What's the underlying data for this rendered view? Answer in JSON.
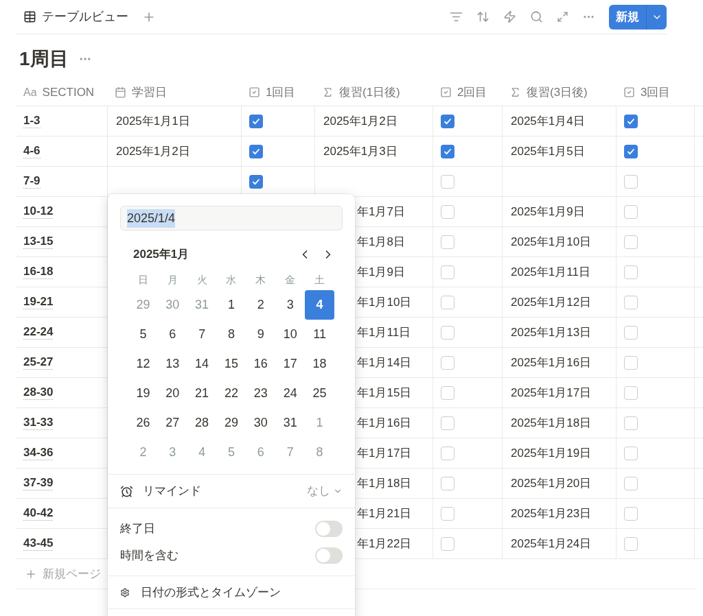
{
  "toolbar": {
    "view_tab": "テーブルビュー",
    "new_button": "新規"
  },
  "title": "1周目",
  "table": {
    "columns": [
      {
        "kind": "title",
        "prefix": "Aa",
        "label": "SECTION"
      },
      {
        "kind": "date",
        "label": "学習日"
      },
      {
        "kind": "checkbox",
        "label": "1回目"
      },
      {
        "kind": "formula",
        "label": "復習(1日後)"
      },
      {
        "kind": "checkbox",
        "label": "2回目"
      },
      {
        "kind": "formula",
        "label": "復習(3日後)"
      },
      {
        "kind": "checkbox",
        "label": "3回目"
      }
    ],
    "rows": [
      {
        "section": "1-3",
        "date": "2025年1月1日",
        "check1": true,
        "review1": "2025年1月2日",
        "check2": true,
        "review3": "2025年1月4日",
        "check3": true
      },
      {
        "section": "4-6",
        "date": "2025年1月2日",
        "check1": true,
        "review1": "2025年1月3日",
        "check2": true,
        "review3": "2025年1月5日",
        "check3": true
      },
      {
        "section": "7-9",
        "check1": true,
        "check2": false,
        "check3": false
      },
      {
        "section": "10-12",
        "review1": "年1月7日",
        "check2": false,
        "review3": "2025年1月9日",
        "check3": false
      },
      {
        "section": "13-15",
        "review1": "年1月8日",
        "check2": false,
        "review3": "2025年1月10日",
        "check3": false
      },
      {
        "section": "16-18",
        "review1": "年1月9日",
        "check2": false,
        "review3": "2025年1月11日",
        "check3": false
      },
      {
        "section": "19-21",
        "review1": "年1月10日",
        "check2": false,
        "review3": "2025年1月12日",
        "check3": false
      },
      {
        "section": "22-24",
        "review1": "年1月11日",
        "check2": false,
        "review3": "2025年1月13日",
        "check3": false
      },
      {
        "section": "25-27",
        "review1": "年1月14日",
        "check2": false,
        "review3": "2025年1月16日",
        "check3": false
      },
      {
        "section": "28-30",
        "review1": "年1月15日",
        "check2": false,
        "review3": "2025年1月17日",
        "check3": false
      },
      {
        "section": "31-33",
        "review1": "年1月16日",
        "check2": false,
        "review3": "2025年1月18日",
        "check3": false
      },
      {
        "section": "34-36",
        "review1": "年1月17日",
        "check2": false,
        "review3": "2025年1月19日",
        "check3": false
      },
      {
        "section": "37-39",
        "review1": "年1月18日",
        "check2": false,
        "review3": "2025年1月20日",
        "check3": false
      },
      {
        "section": "40-42",
        "review1": "年1月21日",
        "check2": false,
        "review3": "2025年1月23日",
        "check3": false
      },
      {
        "section": "43-45",
        "review1": "年1月22日",
        "check2": false,
        "review3": "2025年1月24日",
        "check3": false
      }
    ],
    "new_page": "新規ページ"
  },
  "date_picker": {
    "value": "2025/1/4",
    "month": "2025年1月",
    "weekdays": [
      "日",
      "月",
      "火",
      "水",
      "木",
      "金",
      "土"
    ],
    "weeks": [
      [
        {
          "day": "29",
          "muted": true,
          "selected": false
        },
        {
          "day": "30",
          "muted": true,
          "selected": false
        },
        {
          "day": "31",
          "muted": true,
          "selected": false
        },
        {
          "day": "1",
          "muted": false,
          "selected": false
        },
        {
          "day": "2",
          "muted": false,
          "selected": false
        },
        {
          "day": "3",
          "muted": false,
          "selected": false
        },
        {
          "day": "4",
          "muted": false,
          "selected": true
        }
      ],
      [
        {
          "day": "5",
          "muted": false,
          "selected": false
        },
        {
          "day": "6",
          "muted": false,
          "selected": false
        },
        {
          "day": "7",
          "muted": false,
          "selected": false
        },
        {
          "day": "8",
          "muted": false,
          "selected": false
        },
        {
          "day": "9",
          "muted": false,
          "selected": false
        },
        {
          "day": "10",
          "muted": false,
          "selected": false
        },
        {
          "day": "11",
          "muted": false,
          "selected": false
        }
      ],
      [
        {
          "day": "12",
          "muted": false,
          "selected": false
        },
        {
          "day": "13",
          "muted": false,
          "selected": false
        },
        {
          "day": "14",
          "muted": false,
          "selected": false
        },
        {
          "day": "15",
          "muted": false,
          "selected": false
        },
        {
          "day": "16",
          "muted": false,
          "selected": false
        },
        {
          "day": "17",
          "muted": false,
          "selected": false
        },
        {
          "day": "18",
          "muted": false,
          "selected": false
        }
      ],
      [
        {
          "day": "19",
          "muted": false,
          "selected": false
        },
        {
          "day": "20",
          "muted": false,
          "selected": false
        },
        {
          "day": "21",
          "muted": false,
          "selected": false
        },
        {
          "day": "22",
          "muted": false,
          "selected": false
        },
        {
          "day": "23",
          "muted": false,
          "selected": false
        },
        {
          "day": "24",
          "muted": false,
          "selected": false
        },
        {
          "day": "25",
          "muted": false,
          "selected": false
        }
      ],
      [
        {
          "day": "26",
          "muted": false,
          "selected": false
        },
        {
          "day": "27",
          "muted": false,
          "selected": false
        },
        {
          "day": "28",
          "muted": false,
          "selected": false
        },
        {
          "day": "29",
          "muted": false,
          "selected": false
        },
        {
          "day": "30",
          "muted": false,
          "selected": false
        },
        {
          "day": "31",
          "muted": false,
          "selected": false
        },
        {
          "day": "1",
          "muted": true,
          "selected": false
        }
      ],
      [
        {
          "day": "2",
          "muted": true,
          "selected": false
        },
        {
          "day": "3",
          "muted": true,
          "selected": false
        },
        {
          "day": "4",
          "muted": true,
          "selected": false
        },
        {
          "day": "5",
          "muted": true,
          "selected": false
        },
        {
          "day": "6",
          "muted": true,
          "selected": false
        },
        {
          "day": "7",
          "muted": true,
          "selected": false
        },
        {
          "day": "8",
          "muted": true,
          "selected": false
        }
      ]
    ],
    "remind": {
      "label": "リマインド",
      "value": "なし"
    },
    "toggles": [
      {
        "label": "終了日",
        "on": false
      },
      {
        "label": "時間を含む",
        "on": false
      }
    ],
    "format_link": "日付の形式とタイムゾーン"
  }
}
